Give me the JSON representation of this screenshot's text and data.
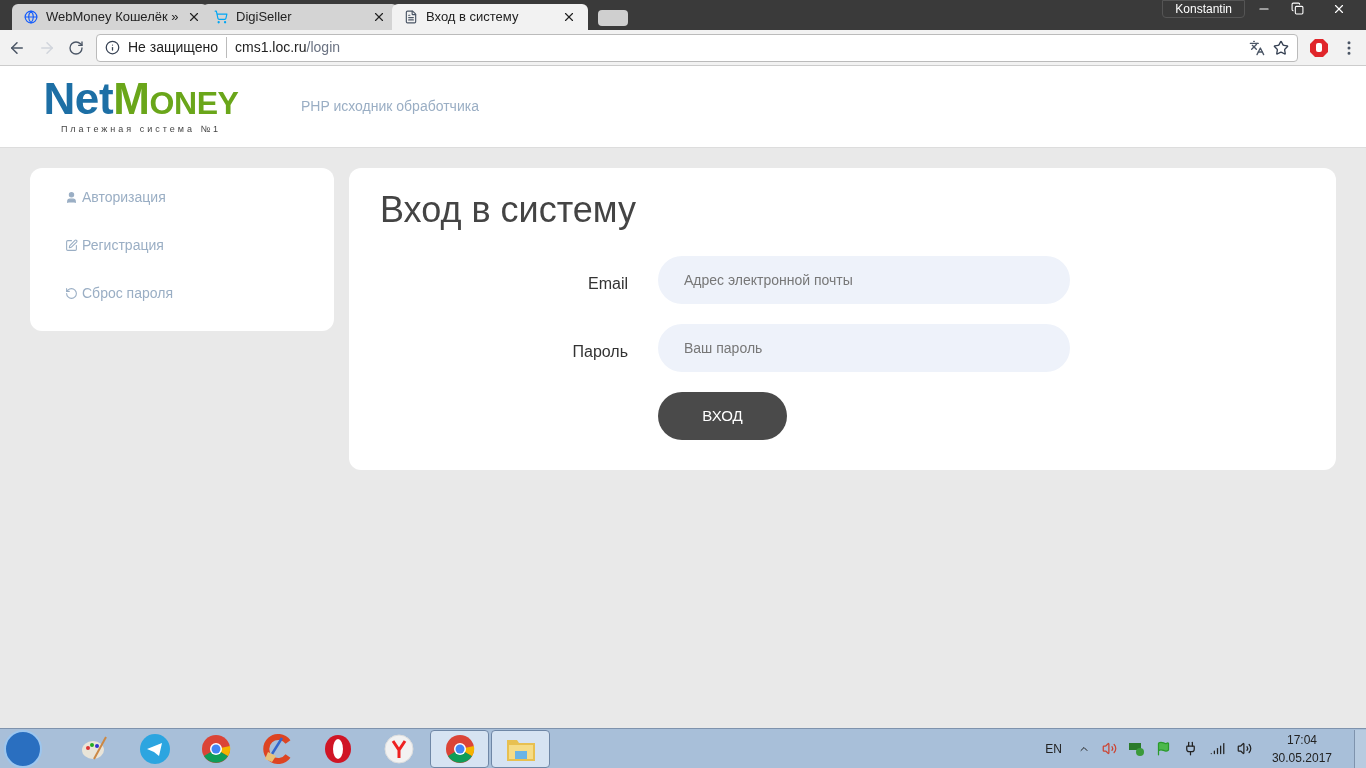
{
  "browser": {
    "tabs": [
      {
        "title": "WebMoney Кошелёк »",
        "kind": "globe",
        "selected": false
      },
      {
        "title": "DigiSeller",
        "kind": "cart",
        "selected": false
      },
      {
        "title": "Вход в систему",
        "kind": "page",
        "selected": true
      }
    ],
    "profile": "Konstantin",
    "address": {
      "security": "Не защищено",
      "host": "cms1.loc.ru",
      "path": "/login"
    }
  },
  "header": {
    "logo": {
      "part_1": "Net",
      "part_2": "M",
      "part_3": "ONEY",
      "tagline": "Платежная система №1"
    },
    "link": "PHP исходник обработчика"
  },
  "sidebar": {
    "items": [
      {
        "label": "Авторизация",
        "kind": "user"
      },
      {
        "label": "Регистрация",
        "kind": "edit"
      },
      {
        "label": "Сброс пароля",
        "kind": "undo"
      }
    ]
  },
  "main": {
    "title": "Вход в систему",
    "fields": [
      {
        "label": "Email",
        "placeholder": "Адрес электронной почты"
      },
      {
        "label": "Пароль",
        "placeholder": "Ваш пароль"
      }
    ],
    "submit": "ВХОД"
  },
  "taskbar": {
    "apps": [
      {
        "kind": "paint",
        "active": false
      },
      {
        "kind": "telegram",
        "active": false
      },
      {
        "kind": "chrome",
        "active": false
      },
      {
        "kind": "ccleaner",
        "active": false
      },
      {
        "kind": "opera",
        "active": false
      },
      {
        "kind": "yandex",
        "active": false
      },
      {
        "kind": "chrome",
        "active": true
      },
      {
        "kind": "folder",
        "active": true
      }
    ],
    "language": "EN",
    "time": "17:04",
    "date": "30.05.2017"
  }
}
